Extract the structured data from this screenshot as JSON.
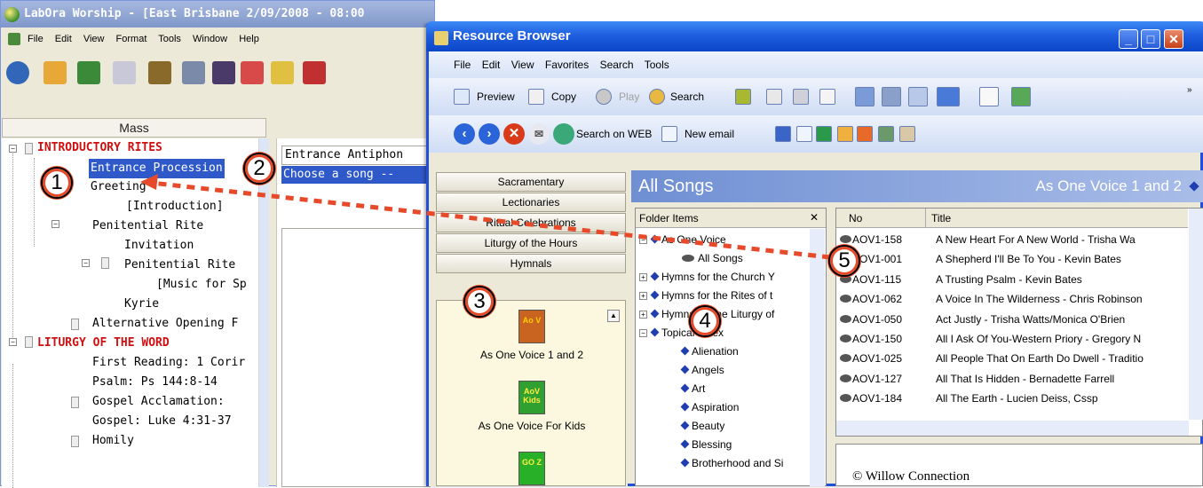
{
  "back_window": {
    "title": "LabOra Worship - [East Brisbane 2/09/2008 - 08:00",
    "menu": [
      "File",
      "Edit",
      "View",
      "Format",
      "Tools",
      "Window",
      "Help"
    ],
    "mass_header": "Mass",
    "tree": [
      {
        "label": "INTRODUCTORY RITES",
        "style": "red"
      },
      {
        "label": "Entrance Procession",
        "style": "selected"
      },
      {
        "label": "Greeting",
        "style": ""
      },
      {
        "label": "[Introduction]",
        "style": ""
      },
      {
        "label": "Penitential Rite",
        "style": ""
      },
      {
        "label": "Invitation",
        "style": ""
      },
      {
        "label": "Penitential Rite",
        "style": ""
      },
      {
        "label": "[Music for Sp",
        "style": ""
      },
      {
        "label": "Kyrie",
        "style": ""
      },
      {
        "label": "Alternative Opening F",
        "style": ""
      },
      {
        "label": "LITURGY OF THE WORD",
        "style": "red"
      },
      {
        "label": "First Reading: 1 Corir",
        "style": ""
      },
      {
        "label": "Psalm: Ps 144:8-14",
        "style": ""
      },
      {
        "label": "Gospel Acclamation:",
        "style": ""
      },
      {
        "label": "Gospel: Luke 4:31-37",
        "style": ""
      },
      {
        "label": "Homily",
        "style": ""
      }
    ],
    "antiphon_header": "Entrance Antiphon",
    "antiphon_selected": "Choose a song --"
  },
  "resource_browser": {
    "title": "Resource Browser",
    "window_buttons": {
      "minimize": "_",
      "maximize": "□",
      "close": "✕"
    },
    "menu": [
      "File",
      "Edit",
      "View",
      "Favorites",
      "Search",
      "Tools"
    ],
    "toolbar1": {
      "preview": "Preview",
      "copy": "Copy",
      "play": "Play",
      "search": "Search"
    },
    "toolbar2": {
      "search_web": "Search on WEB",
      "new_email": "New email"
    },
    "nav_tabs": [
      "Sacramentary",
      "Lectionaries",
      "Ritual Celebrations",
      "Liturgy of the Hours",
      "Hymnals"
    ],
    "hymnals": [
      {
        "label": "As One Voice 1 and 2",
        "icon_text": "Ao V",
        "color": "#d2691e"
      },
      {
        "label": "As One Voice For Kids",
        "icon_text": "AoV Kids",
        "color": "#3cab3c"
      },
      {
        "label": "",
        "icon_text": "GO Z",
        "color": "#32b832"
      }
    ],
    "header_title": "All Songs",
    "header_right": "As One Voice 1 and 2",
    "folder_header": "Folder Items",
    "folder_close": "✕",
    "folders": [
      {
        "label": "As One Voice",
        "level": 1,
        "exp": "-"
      },
      {
        "label": "All Songs",
        "level": 2,
        "exp": ""
      },
      {
        "label": "Hymns for the Church Y",
        "level": 1,
        "exp": "+"
      },
      {
        "label": "Hymns for the Rites of t",
        "level": 1,
        "exp": "+"
      },
      {
        "label": "Hymns for the Liturgy of",
        "level": 1,
        "exp": "+"
      },
      {
        "label": "Topical Index",
        "level": 1,
        "exp": "-"
      },
      {
        "label": "Alienation",
        "level": 2,
        "exp": ""
      },
      {
        "label": "Angels",
        "level": 2,
        "exp": ""
      },
      {
        "label": "Art",
        "level": 2,
        "exp": ""
      },
      {
        "label": "Aspiration",
        "level": 2,
        "exp": ""
      },
      {
        "label": "Beauty",
        "level": 2,
        "exp": ""
      },
      {
        "label": "Blessing",
        "level": 2,
        "exp": ""
      },
      {
        "label": "Brotherhood and Si",
        "level": 2,
        "exp": ""
      }
    ],
    "columns": [
      "No",
      "Title"
    ],
    "songs": [
      {
        "no": "AOV1-158",
        "title": "A New Heart For A New World - Trisha Wa"
      },
      {
        "no": "AOV1-001",
        "title": "A Shepherd I'll Be To You - Kevin Bates"
      },
      {
        "no": "AOV1-115",
        "title": "A Trusting Psalm - Kevin Bates"
      },
      {
        "no": "AOV1-062",
        "title": "A Voice In The Wilderness - Chris Robinson"
      },
      {
        "no": "AOV1-050",
        "title": "Act Justly - Trisha Watts/Monica O'Brien"
      },
      {
        "no": "AOV1-150",
        "title": "All I Ask Of You-Western Priory - Gregory N"
      },
      {
        "no": "AOV1-025",
        "title": "All People That On Earth Do Dwell - Traditio"
      },
      {
        "no": "AOV1-127",
        "title": "All That Is Hidden - Bernadette Farrell"
      },
      {
        "no": "AOV1-184",
        "title": "All The Earth - Lucien Deiss, Cssp"
      }
    ],
    "copyright": "© Willow Connection"
  },
  "callouts": [
    "1",
    "2",
    "3",
    "4",
    "5"
  ],
  "colors": {
    "accent_red": "#e64a2a",
    "selection_blue": "#2f58c8",
    "xp_title_blue": "#1f5fe0"
  }
}
